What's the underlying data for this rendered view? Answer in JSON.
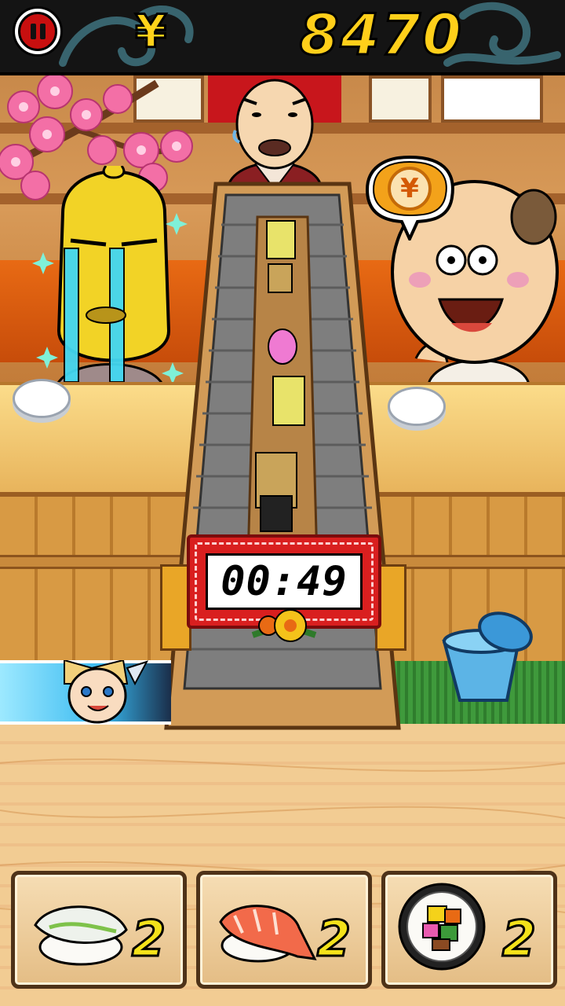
{
  "hud": {
    "currency_symbol": "¥",
    "score": "8470",
    "pause_icon": "pause-icon"
  },
  "timer": {
    "display": "00:49"
  },
  "customer_bubble": {
    "symbol": "¥"
  },
  "menu_cards": [
    {
      "item": "squid-nigiri",
      "icon": "squid-nigiri-icon",
      "count": "2"
    },
    {
      "item": "shrimp-nigiri",
      "icon": "shrimp-nigiri-icon",
      "count": "2"
    },
    {
      "item": "futomaki-roll",
      "icon": "futomaki-roll-icon",
      "count": "2"
    }
  ],
  "colors": {
    "score_yellow": "#ffcf1a",
    "pause_red": "#c80f0f",
    "timer_red": "#d91f1f",
    "count_yellow": "#f4e21a"
  }
}
